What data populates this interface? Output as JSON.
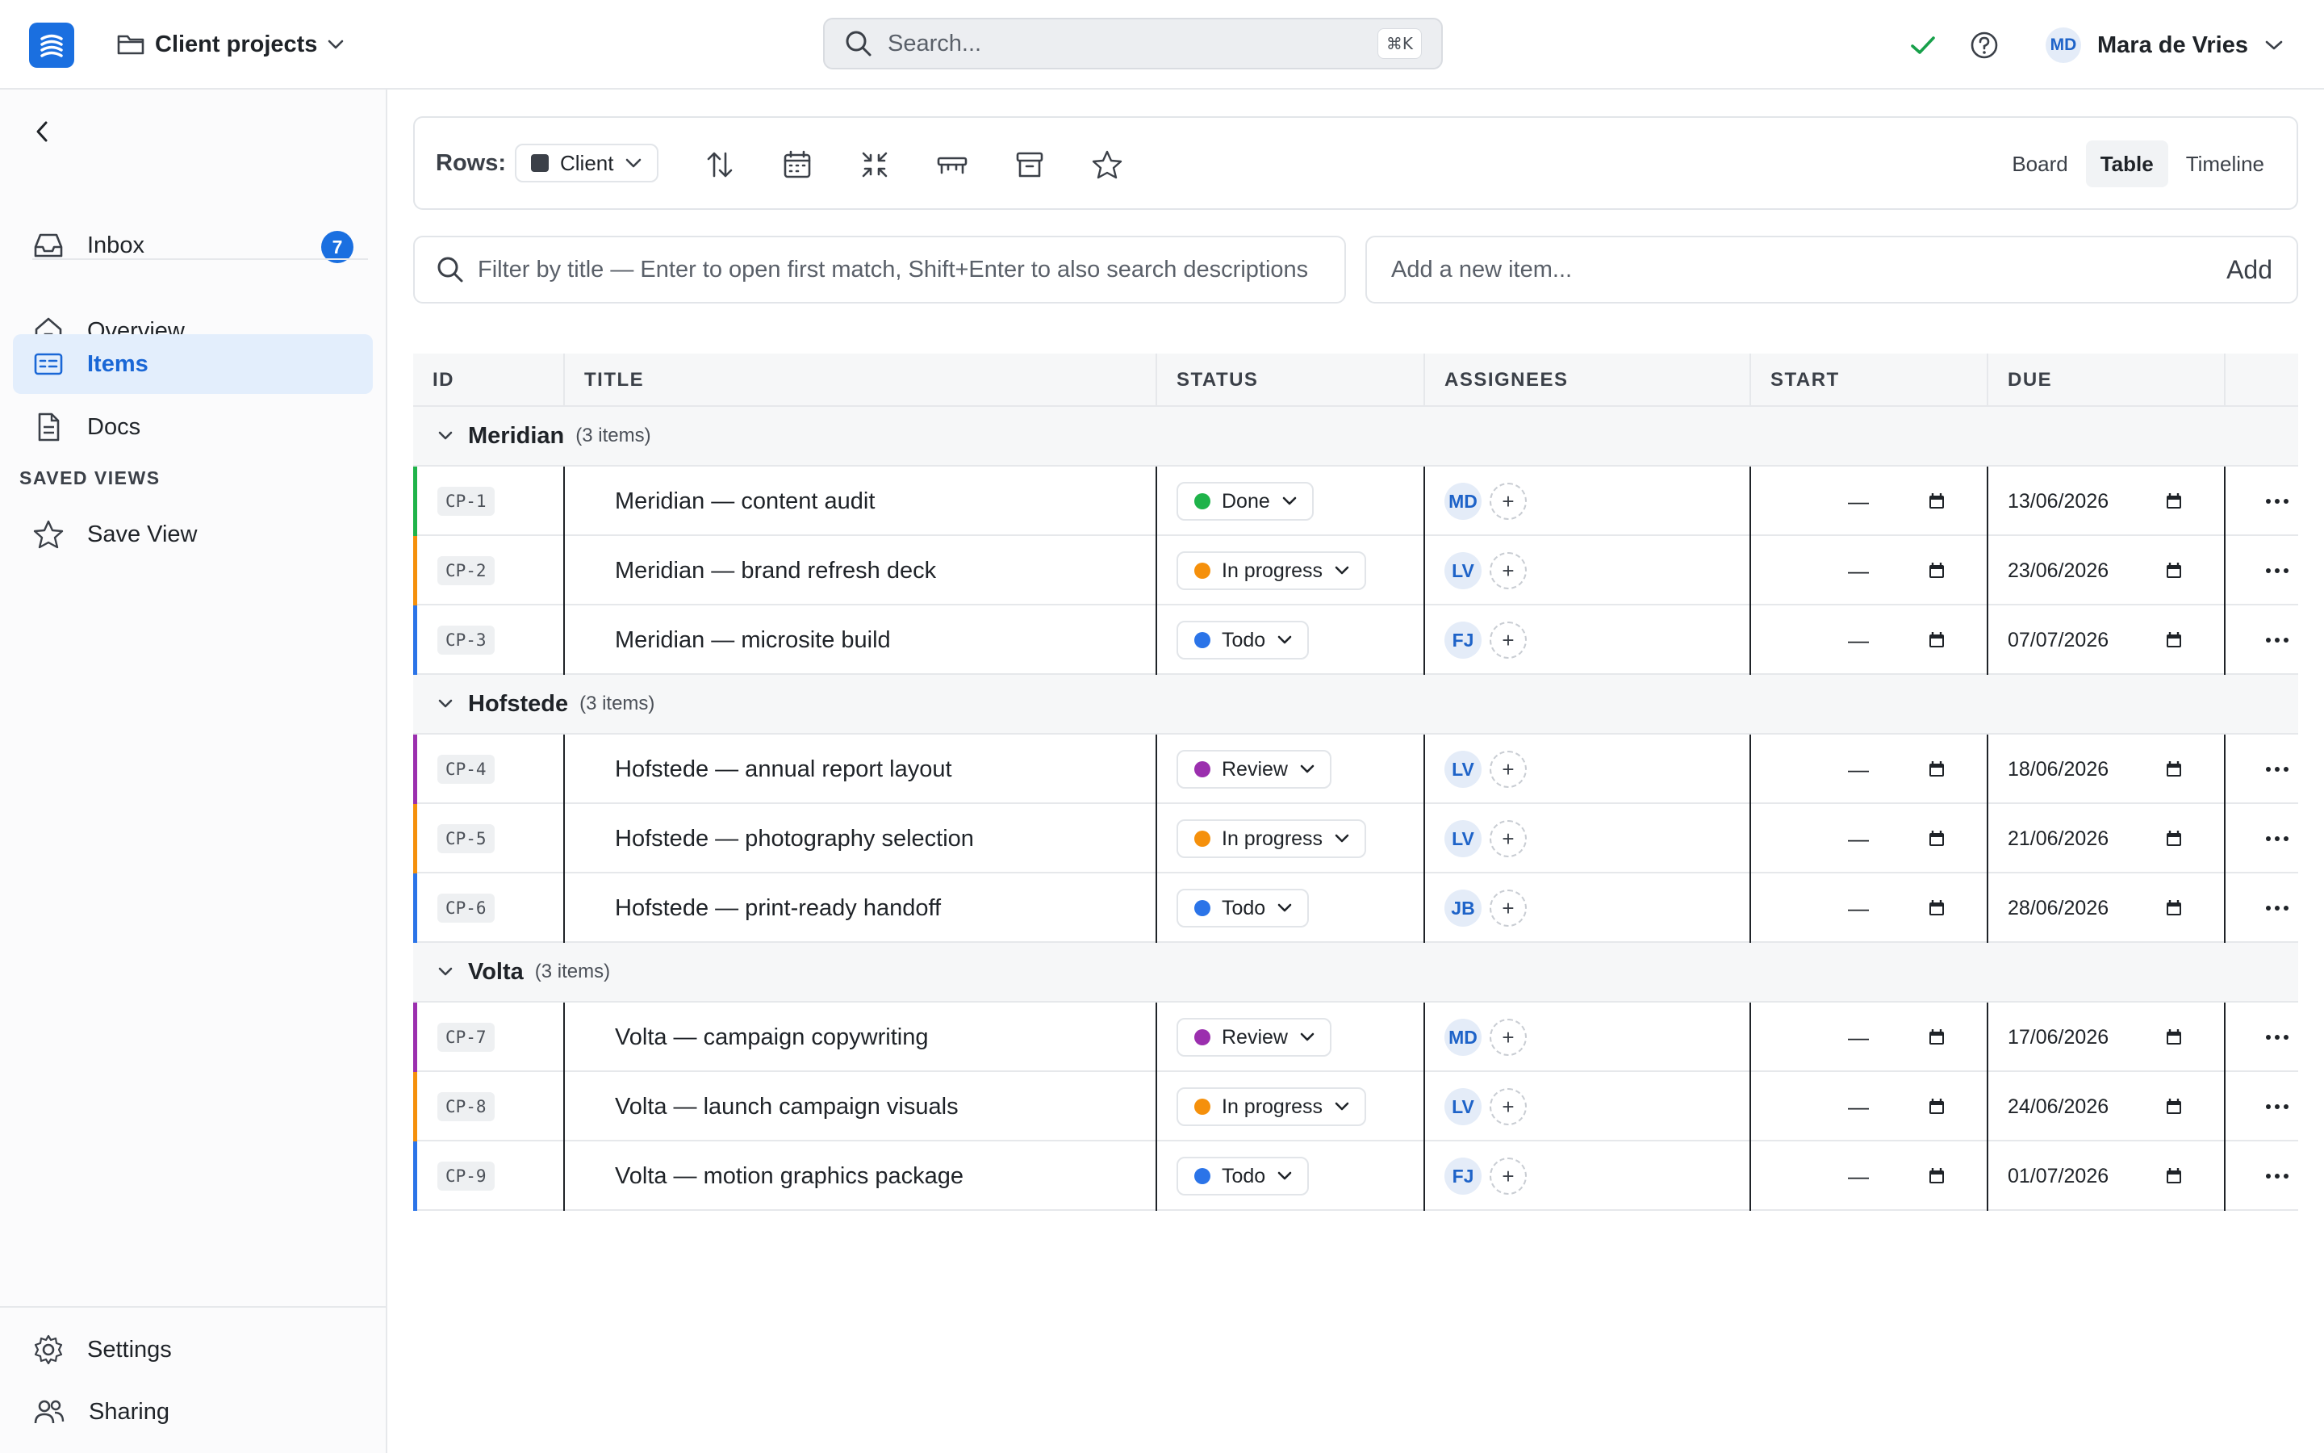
{
  "topbar": {
    "project": "Client projects",
    "search_placeholder": "Search...",
    "search_shortcut": "⌘K",
    "user_initials": "MD",
    "user_name": "Mara de Vries"
  },
  "sidebar": {
    "items": [
      {
        "label": "Inbox",
        "badge": "7",
        "icon": "inbox-icon"
      },
      {
        "label": "Overview",
        "icon": "home-icon"
      },
      {
        "label": "Items",
        "icon": "items-icon",
        "active": true
      },
      {
        "label": "Docs",
        "icon": "document-icon"
      }
    ],
    "saved_views_label": "SAVED VIEWS",
    "save_view_label": "Save View",
    "bottom": [
      {
        "label": "Settings",
        "icon": "gear-icon"
      },
      {
        "label": "Sharing",
        "icon": "people-icon"
      }
    ]
  },
  "toolbar": {
    "rows_label": "Rows:",
    "rows_value": "Client",
    "views": [
      "Board",
      "Table",
      "Timeline"
    ],
    "active_view": "Table"
  },
  "filter": {
    "placeholder": "Filter by title — Enter to open first match, Shift+Enter to also search descriptions"
  },
  "add_item": {
    "placeholder": "Add a new item...",
    "button": "Add"
  },
  "table": {
    "columns": [
      "ID",
      "TITLE",
      "STATUS",
      "ASSIGNEES",
      "START",
      "DUE"
    ],
    "empty_start": "—",
    "groups": [
      {
        "name": "Meridian",
        "count": "(3 items)",
        "rows": [
          {
            "id": "CP-1",
            "title": "Meridian — content audit",
            "status": "Done",
            "status_color": "#1fb34a",
            "accent": "#1fb34a",
            "assignee": "MD",
            "due": "13/06/2026"
          },
          {
            "id": "CP-2",
            "title": "Meridian — brand refresh deck",
            "status": "In progress",
            "status_color": "#f5900b",
            "accent": "#f5900b",
            "assignee": "LV",
            "due": "23/06/2026"
          },
          {
            "id": "CP-3",
            "title": "Meridian — microsite build",
            "status": "Todo",
            "status_color": "#2b74e8",
            "accent": "#2b74e8",
            "assignee": "FJ",
            "due": "07/07/2026"
          }
        ]
      },
      {
        "name": "Hofstede",
        "count": "(3 items)",
        "rows": [
          {
            "id": "CP-4",
            "title": "Hofstede — annual report layout",
            "status": "Review",
            "status_color": "#9b2fae",
            "accent": "#9b2fae",
            "assignee": "LV",
            "due": "18/06/2026"
          },
          {
            "id": "CP-5",
            "title": "Hofstede — photography selection",
            "status": "In progress",
            "status_color": "#f5900b",
            "accent": "#f5900b",
            "assignee": "LV",
            "due": "21/06/2026"
          },
          {
            "id": "CP-6",
            "title": "Hofstede — print-ready handoff",
            "status": "Todo",
            "status_color": "#2b74e8",
            "accent": "#2b74e8",
            "assignee": "JB",
            "due": "28/06/2026"
          }
        ]
      },
      {
        "name": "Volta",
        "count": "(3 items)",
        "rows": [
          {
            "id": "CP-7",
            "title": "Volta — campaign copywriting",
            "status": "Review",
            "status_color": "#9b2fae",
            "accent": "#9b2fae",
            "assignee": "MD",
            "due": "17/06/2026"
          },
          {
            "id": "CP-8",
            "title": "Volta — launch campaign visuals",
            "status": "In progress",
            "status_color": "#f5900b",
            "accent": "#f5900b",
            "assignee": "LV",
            "due": "24/06/2026"
          },
          {
            "id": "CP-9",
            "title": "Volta — motion graphics package",
            "status": "Todo",
            "status_color": "#2b74e8",
            "accent": "#2b74e8",
            "assignee": "FJ",
            "due": "01/07/2026"
          }
        ]
      }
    ]
  }
}
